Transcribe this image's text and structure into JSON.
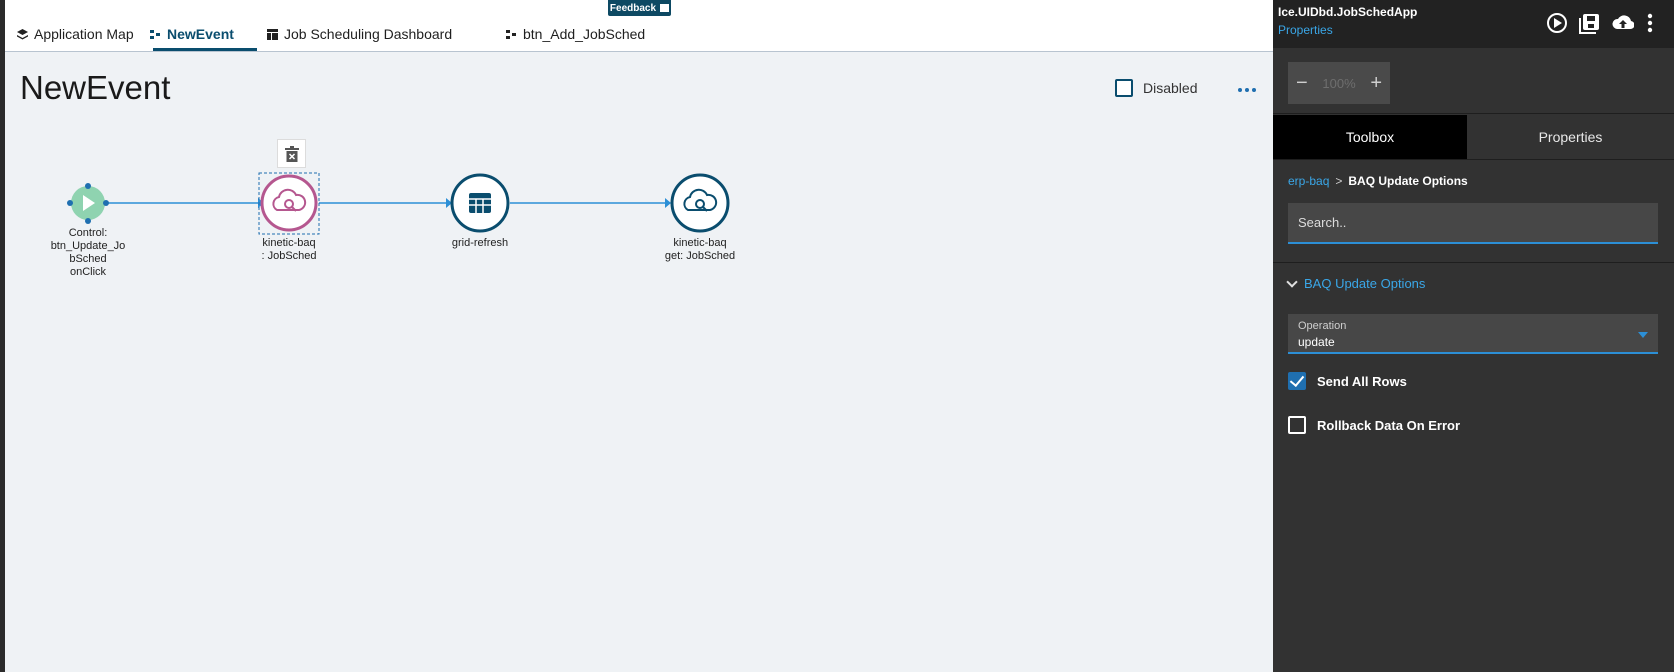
{
  "tabs": [
    {
      "label": "Application Map",
      "icon": "layers-icon"
    },
    {
      "label": "NewEvent",
      "icon": "event-icon"
    },
    {
      "label": "Job Scheduling Dashboard",
      "icon": "dashboard-icon"
    },
    {
      "label": "btn_Add_JobSched",
      "icon": "event-icon"
    }
  ],
  "feedback_label": "Feedback",
  "page_title": "NewEvent",
  "disabled_label": "Disabled",
  "diagram": {
    "nodes": [
      {
        "label_lines": [
          "Control:",
          "btn_Update_Jo",
          "bSched",
          "onClick"
        ],
        "icon": "play-icon",
        "color": "#8fd3b0"
      },
      {
        "label_lines": [
          "kinetic-baq",
          ": JobSched"
        ],
        "icon": "cloud-search-icon",
        "color": "#b5578f"
      },
      {
        "label_lines": [
          "grid-refresh"
        ],
        "icon": "grid-icon",
        "color": "#0a4d6e"
      },
      {
        "label_lines": [
          "kinetic-baq",
          "get: JobSched"
        ],
        "icon": "cloud-search-icon",
        "color": "#0a4d6e"
      }
    ]
  },
  "panel": {
    "app_name": "Ice.UIDbd.JobSchedApp",
    "app_sub": "Properties",
    "zoom": "100%",
    "tabs": [
      "Toolbox",
      "Properties"
    ],
    "breadcrumb": {
      "link": "erp-baq",
      "separator": ">",
      "current": "BAQ Update Options"
    },
    "search_placeholder": "Search..",
    "section_title": "BAQ Update Options",
    "operation": {
      "label": "Operation",
      "value": "update"
    },
    "checkboxes": [
      {
        "label": "Send All Rows",
        "checked": true
      },
      {
        "label": "Rollback Data On Error",
        "checked": false
      }
    ]
  },
  "colors": {
    "accent": "#0a4d6e",
    "link": "#3aa7e8",
    "panel_bg": "#323232"
  }
}
